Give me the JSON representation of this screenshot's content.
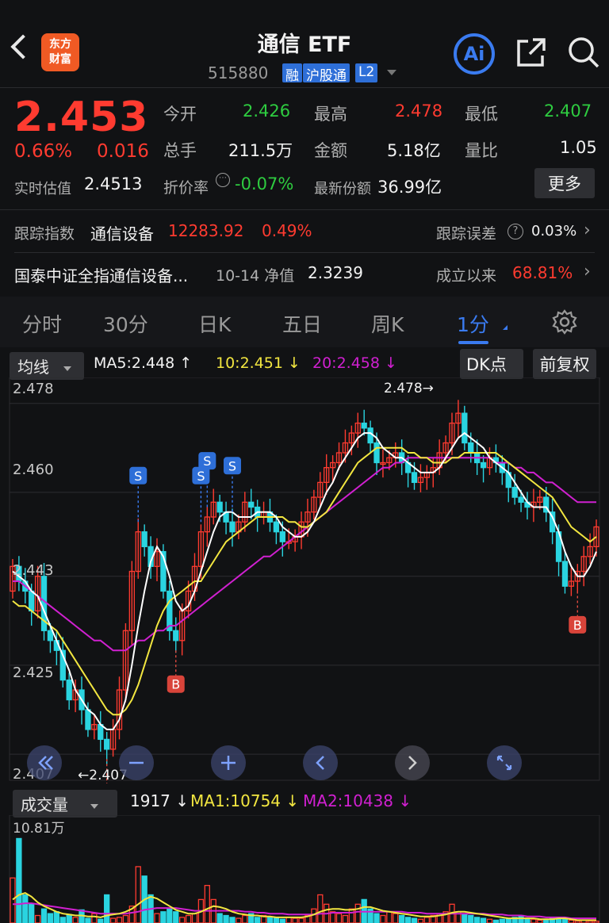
{
  "header": {
    "title": "通信 ETF",
    "code": "515880",
    "tags": [
      "融",
      "沪股通",
      "L2"
    ],
    "logo_text": [
      "东方",
      "财富"
    ],
    "ai_label": "Ai"
  },
  "quote": {
    "price": "2.453",
    "change_pct": "0.66%",
    "change": "0.016",
    "open_label": "今开",
    "open": "2.426",
    "high_label": "最高",
    "high": "2.478",
    "low_label": "最低",
    "low": "2.407",
    "volume_label": "总手",
    "volume": "211.5万",
    "amount_label": "金额",
    "amount": "5.18亿",
    "ratio_label": "量比",
    "ratio": "1.05",
    "iopv_label": "实时估值",
    "iopv": "2.4513",
    "discount_label": "折价率",
    "discount": "-0.07%",
    "shares_label": "最新份额",
    "shares": "36.99亿",
    "more_label": "更多"
  },
  "tracking": {
    "label": "跟踪指数",
    "index_name": "通信设备",
    "index_value": "12283.92",
    "index_pct": "0.49%",
    "error_label": "跟踪误差",
    "error_value": "0.03%"
  },
  "fund": {
    "name": "国泰中证全指通信设备...",
    "nav_label": "10-14 净值",
    "nav": "2.3239",
    "since_label": "成立以来",
    "since_value": "68.81%"
  },
  "tabs": [
    "分时",
    "30分",
    "日K",
    "五日",
    "周K",
    "1分"
  ],
  "active_tab": "1分",
  "toolbar": {
    "ma_select": "均线",
    "ma5": "MA5:2.448",
    "ma10": "10:2.451",
    "ma20": "20:2.458",
    "dk_label": "DK点",
    "adjust_label": "前复权"
  },
  "chart_axis": {
    "y_ticks": [
      "2.478",
      "2.460",
      "2.443",
      "2.425",
      "2.407"
    ],
    "high_marker": "2.478",
    "low_marker": "2.407"
  },
  "volume": {
    "select": "成交量",
    "current": "1917",
    "ma1": "MA1:10754",
    "ma2": "MA2:10438",
    "max_label": "10.81万"
  },
  "colors": {
    "up": "#ff3b30",
    "down": "#2ad4e0",
    "ma5": "#ffffff",
    "ma10": "#f2e640",
    "ma20": "#d020d0",
    "accent": "#3a7bf0"
  },
  "chart_data": {
    "type": "candlestick",
    "ylim": [
      2.403,
      2.481
    ],
    "signals": [
      {
        "type": "S",
        "bar": 20
      },
      {
        "type": "S",
        "bar": 31
      },
      {
        "type": "S",
        "bar": 30
      },
      {
        "type": "S",
        "bar": 35
      },
      {
        "type": "B",
        "bar": 15
      },
      {
        "type": "B",
        "bar": 26
      },
      {
        "type": "B",
        "bar": 90
      }
    ],
    "close": [
      2.445,
      2.442,
      2.44,
      2.436,
      2.443,
      2.432,
      2.43,
      2.428,
      2.422,
      2.418,
      2.42,
      2.416,
      2.412,
      2.413,
      2.41,
      2.408,
      2.412,
      2.42,
      2.432,
      2.444,
      2.452,
      2.449,
      2.445,
      2.448,
      2.44,
      2.432,
      2.43,
      2.436,
      2.44,
      2.445,
      2.452,
      2.455,
      2.458,
      2.456,
      2.454,
      2.452,
      2.454,
      2.458,
      2.457,
      2.455,
      2.456,
      2.454,
      2.452,
      2.45,
      2.45,
      2.451,
      2.454,
      2.456,
      2.459,
      2.462,
      2.465,
      2.466,
      2.468,
      2.47,
      2.472,
      2.474,
      2.473,
      2.47,
      2.466,
      2.466,
      2.467,
      2.468,
      2.466,
      2.464,
      2.462,
      2.463,
      2.464,
      2.465,
      2.468,
      2.47,
      2.474,
      2.476,
      2.47,
      2.468,
      2.466,
      2.465,
      2.467,
      2.466,
      2.464,
      2.461,
      2.459,
      2.458,
      2.457,
      2.458,
      2.459,
      2.456,
      2.452,
      2.446,
      2.441,
      2.442,
      2.444,
      2.447,
      2.449,
      2.453
    ],
    "open": [
      2.44,
      2.445,
      2.442,
      2.44,
      2.436,
      2.443,
      2.432,
      2.43,
      2.428,
      2.422,
      2.418,
      2.42,
      2.416,
      2.412,
      2.413,
      2.41,
      2.408,
      2.412,
      2.42,
      2.432,
      2.444,
      2.452,
      2.449,
      2.445,
      2.448,
      2.44,
      2.432,
      2.43,
      2.436,
      2.44,
      2.445,
      2.452,
      2.455,
      2.458,
      2.456,
      2.454,
      2.452,
      2.454,
      2.458,
      2.457,
      2.455,
      2.456,
      2.454,
      2.452,
      2.45,
      2.45,
      2.451,
      2.454,
      2.456,
      2.459,
      2.462,
      2.465,
      2.466,
      2.468,
      2.47,
      2.472,
      2.474,
      2.473,
      2.47,
      2.466,
      2.466,
      2.467,
      2.468,
      2.466,
      2.464,
      2.462,
      2.463,
      2.464,
      2.465,
      2.468,
      2.47,
      2.474,
      2.476,
      2.47,
      2.468,
      2.466,
      2.465,
      2.467,
      2.466,
      2.464,
      2.461,
      2.459,
      2.458,
      2.457,
      2.458,
      2.459,
      2.456,
      2.452,
      2.446,
      2.441,
      2.442,
      2.444,
      2.447,
      2.449
    ],
    "ma5": [
      2.444,
      2.443,
      2.442,
      2.44,
      2.439,
      2.436,
      2.433,
      2.43,
      2.427,
      2.424,
      2.42,
      2.418,
      2.416,
      2.415,
      2.413,
      2.412,
      2.412,
      2.414,
      2.418,
      2.425,
      2.433,
      2.44,
      2.446,
      2.449,
      2.447,
      2.443,
      2.438,
      2.436,
      2.437,
      2.44,
      2.444,
      2.448,
      2.452,
      2.455,
      2.456,
      2.456,
      2.455,
      2.455,
      2.455,
      2.456,
      2.456,
      2.456,
      2.455,
      2.453,
      2.452,
      2.451,
      2.451,
      2.452,
      2.454,
      2.457,
      2.46,
      2.462,
      2.465,
      2.467,
      2.469,
      2.471,
      2.472,
      2.472,
      2.471,
      2.469,
      2.468,
      2.467,
      2.467,
      2.466,
      2.465,
      2.464,
      2.464,
      2.464,
      2.465,
      2.467,
      2.469,
      2.471,
      2.472,
      2.471,
      2.47,
      2.469,
      2.467,
      2.466,
      2.465,
      2.464,
      2.462,
      2.46,
      2.458,
      2.457,
      2.457,
      2.457,
      2.455,
      2.452,
      2.448,
      2.445,
      2.443,
      2.443,
      2.445,
      2.448
    ],
    "ma10": [
      2.438,
      2.437,
      2.437,
      2.436,
      2.435,
      2.434,
      2.433,
      2.432,
      2.43,
      2.428,
      2.426,
      2.424,
      2.422,
      2.42,
      2.418,
      2.416,
      2.415,
      2.415,
      2.416,
      2.418,
      2.421,
      2.425,
      2.429,
      2.433,
      2.436,
      2.438,
      2.439,
      2.44,
      2.441,
      2.442,
      2.442,
      2.444,
      2.446,
      2.448,
      2.45,
      2.451,
      2.452,
      2.453,
      2.454,
      2.455,
      2.455,
      2.455,
      2.455,
      2.455,
      2.454,
      2.454,
      2.453,
      2.453,
      2.454,
      2.455,
      2.456,
      2.458,
      2.46,
      2.462,
      2.464,
      2.466,
      2.467,
      2.468,
      2.469,
      2.469,
      2.469,
      2.469,
      2.469,
      2.468,
      2.468,
      2.467,
      2.467,
      2.466,
      2.466,
      2.466,
      2.467,
      2.467,
      2.468,
      2.468,
      2.468,
      2.468,
      2.468,
      2.468,
      2.467,
      2.466,
      2.465,
      2.464,
      2.463,
      2.462,
      2.461,
      2.46,
      2.459,
      2.457,
      2.455,
      2.453,
      2.452,
      2.451,
      2.45,
      2.451
    ],
    "ma20": [
      2.442,
      2.442,
      2.441,
      2.44,
      2.439,
      2.438,
      2.437,
      2.436,
      2.435,
      2.434,
      2.433,
      2.432,
      2.431,
      2.43,
      2.43,
      2.429,
      2.428,
      2.428,
      2.428,
      2.429,
      2.43,
      2.43,
      2.431,
      2.432,
      2.432,
      2.433,
      2.433,
      2.434,
      2.435,
      2.436,
      2.437,
      2.438,
      2.439,
      2.44,
      2.441,
      2.442,
      2.443,
      2.444,
      2.445,
      2.446,
      2.447,
      2.447,
      2.448,
      2.449,
      2.45,
      2.451,
      2.452,
      2.453,
      2.454,
      2.455,
      2.456,
      2.457,
      2.458,
      2.459,
      2.46,
      2.461,
      2.462,
      2.463,
      2.464,
      2.465,
      2.465,
      2.466,
      2.466,
      2.467,
      2.467,
      2.467,
      2.467,
      2.467,
      2.467,
      2.467,
      2.467,
      2.467,
      2.467,
      2.467,
      2.467,
      2.467,
      2.467,
      2.466,
      2.466,
      2.466,
      2.465,
      2.465,
      2.464,
      2.464,
      2.463,
      2.462,
      2.462,
      2.461,
      2.46,
      2.459,
      2.458,
      2.458,
      2.458,
      2.458
    ],
    "volume_ylim": [
      0,
      108100
    ],
    "volume": [
      48000,
      90000,
      30000,
      20000,
      8000,
      15000,
      10000,
      12000,
      6000,
      9000,
      6000,
      14000,
      5000,
      10000,
      4000,
      30000,
      5000,
      6000,
      8000,
      18000,
      60000,
      50000,
      30000,
      10000,
      12000,
      15000,
      12000,
      6000,
      8000,
      10000,
      25000,
      40000,
      25000,
      10000,
      8000,
      6000,
      5000,
      8000,
      10000,
      6000,
      8000,
      6000,
      5000,
      4000,
      6000,
      5000,
      5000,
      8000,
      15000,
      30000,
      20000,
      12000,
      10000,
      8000,
      15000,
      20000,
      25000,
      15000,
      10000,
      8000,
      12000,
      10000,
      8000,
      6000,
      5000,
      4000,
      6000,
      8000,
      10000,
      12000,
      20000,
      12000,
      10000,
      8000,
      6000,
      5000,
      4000,
      3000,
      4000,
      5000,
      6000,
      8000,
      5000,
      4000,
      3000,
      4000,
      5000,
      6000,
      4000,
      3000,
      2000,
      3000,
      2000,
      1917
    ],
    "vol_ma1": [
      25000,
      30000,
      32000,
      28000,
      22000,
      18000,
      15000,
      12000,
      10000,
      9000,
      8000,
      8000,
      7000,
      7000,
      6000,
      8000,
      9000,
      10000,
      12000,
      15000,
      20000,
      25000,
      28000,
      26000,
      22000,
      18000,
      14000,
      12000,
      10000,
      10000,
      12000,
      15000,
      18000,
      17000,
      15000,
      12000,
      10000,
      9000,
      8000,
      8000,
      7000,
      7000,
      6000,
      6000,
      6000,
      6000,
      6000,
      7000,
      9000,
      12000,
      14000,
      15000,
      15000,
      14000,
      14000,
      15000,
      17000,
      17000,
      15000,
      13000,
      12000,
      11000,
      10000,
      9000,
      8000,
      7000,
      7000,
      7000,
      8000,
      9000,
      11000,
      12000,
      12000,
      11000,
      10000,
      9000,
      8000,
      7000,
      6000,
      5000,
      5000,
      5000,
      5000,
      5000,
      4000,
      4000,
      4000,
      5000,
      5000,
      4000,
      3000,
      3000,
      3000,
      3000
    ],
    "vol_ma2": [
      20000,
      20000,
      21000,
      21000,
      20000,
      19000,
      18000,
      17000,
      16000,
      15000,
      14000,
      13000,
      12000,
      11000,
      10000,
      10000,
      10000,
      10000,
      10000,
      11000,
      12000,
      14000,
      15000,
      16000,
      16000,
      16000,
      16000,
      15000,
      14000,
      13000,
      13000,
      13000,
      13000,
      13000,
      13000,
      13000,
      13000,
      12000,
      12000,
      11000,
      11000,
      10000,
      10000,
      10000,
      9000,
      9000,
      9000,
      9000,
      9000,
      10000,
      10000,
      11000,
      11000,
      11000,
      11000,
      12000,
      12000,
      12000,
      12000,
      12000,
      12000,
      12000,
      12000,
      11000,
      11000,
      11000,
      10000,
      10000,
      10000,
      10000,
      10000,
      10000,
      10000,
      10000,
      10000,
      10000,
      9000,
      9000,
      9000,
      8000,
      8000,
      8000,
      7000,
      7000,
      7000,
      6000,
      6000,
      6000,
      6000,
      5000,
      5000,
      5000,
      5000,
      5000
    ]
  }
}
